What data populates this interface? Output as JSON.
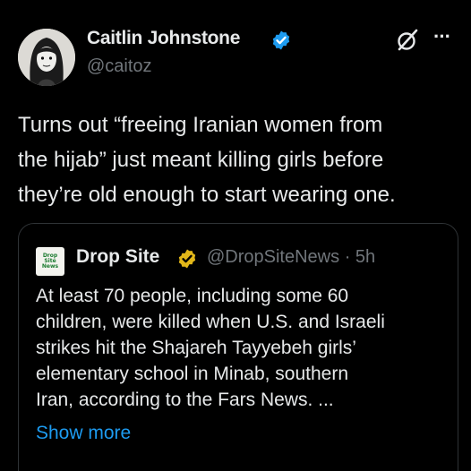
{
  "author": {
    "name": "Caitlin Johnstone",
    "handle": "@caitoz",
    "verified": true,
    "badge_color": "#1d9bf0"
  },
  "icons": {
    "grok": "grok-icon",
    "more": "more-options-icon",
    "more_glyph": "···"
  },
  "tweet": {
    "lines": [
      "Turns out “freeing Iranian women from",
      "the hijab” just meant killing girls before",
      "they’re old enough to start wearing one."
    ]
  },
  "quote": {
    "avatar_text": [
      "Drop",
      "Site",
      "News"
    ],
    "name": "Drop Site",
    "badge_color": "#e2b719",
    "handle": "@DropSiteNews",
    "separator": "·",
    "time": "5h",
    "lines": [
      "At least 70 people, including some 60",
      "children, were killed when U.S. and Israeli",
      "strikes hit the Shajareh Tayyebeh girls’",
      "elementary school in Minab, southern",
      "Iran, according to the Fars News. ..."
    ],
    "show_more": "Show more",
    "link_color": "#1d9bf0"
  }
}
